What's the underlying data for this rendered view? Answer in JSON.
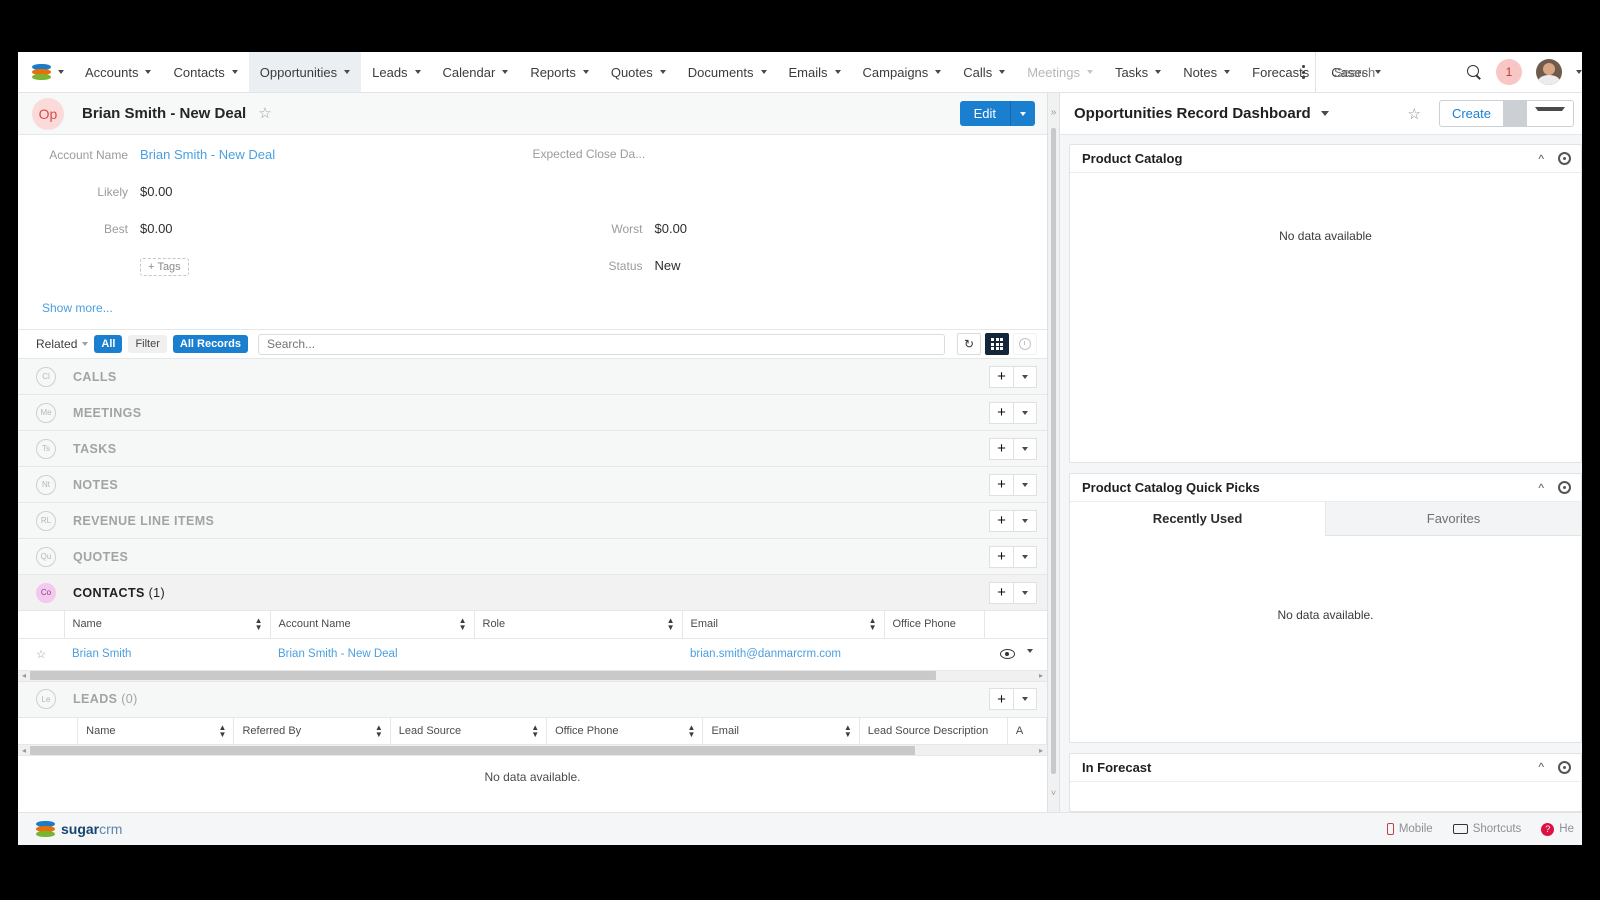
{
  "nav": {
    "logo_icon": "sugarcrm-logo-icon",
    "items": [
      {
        "label": "Accounts",
        "has_caret": true,
        "state": "normal"
      },
      {
        "label": "Contacts",
        "has_caret": true,
        "state": "normal"
      },
      {
        "label": "Opportunities",
        "has_caret": true,
        "state": "active"
      },
      {
        "label": "Leads",
        "has_caret": true,
        "state": "normal"
      },
      {
        "label": "Calendar",
        "has_caret": true,
        "state": "normal"
      },
      {
        "label": "Reports",
        "has_caret": true,
        "state": "normal"
      },
      {
        "label": "Quotes",
        "has_caret": true,
        "state": "normal"
      },
      {
        "label": "Documents",
        "has_caret": true,
        "state": "normal"
      },
      {
        "label": "Emails",
        "has_caret": true,
        "state": "normal"
      },
      {
        "label": "Campaigns",
        "has_caret": true,
        "state": "normal"
      },
      {
        "label": "Calls",
        "has_caret": true,
        "state": "normal"
      },
      {
        "label": "Meetings",
        "has_caret": true,
        "state": "dim"
      },
      {
        "label": "Tasks",
        "has_caret": true,
        "state": "normal"
      },
      {
        "label": "Notes",
        "has_caret": true,
        "state": "normal"
      },
      {
        "label": "Forecasts",
        "has_caret": false,
        "state": "normal"
      },
      {
        "label": "Cases",
        "has_caret": true,
        "state": "normal"
      }
    ],
    "search_placeholder": "Search",
    "notification_count": "1"
  },
  "record": {
    "avatar_initials": "Op",
    "title": "Brian Smith - New Deal",
    "favorite_icon": "star-outline-icon",
    "edit_label": "Edit",
    "fields": [
      {
        "label": "Account Name",
        "value": "Brian Smith - New Deal",
        "is_link": true
      },
      {
        "label": "Expected Close Da...",
        "value": ""
      },
      {
        "label": "Likely",
        "value": "$0.00"
      },
      {
        "label": "Best",
        "value": "$0.00"
      },
      {
        "label": "Worst",
        "value": "$0.00"
      },
      {
        "label": "Status",
        "value": "New"
      }
    ],
    "tags_label": "Tags",
    "show_more_label": "Show more..."
  },
  "filterbar": {
    "related_label": "Related",
    "all_label": "All",
    "filter_label": "Filter",
    "all_records_label": "All Records",
    "search_placeholder": "Search...",
    "refresh_icon": "refresh-icon",
    "grid_icon": "grid-view-icon",
    "timeline_icon": "timeline-view-icon"
  },
  "panels": [
    {
      "badge": "Cl",
      "title": "CALLS",
      "count": "",
      "state": "collapsed"
    },
    {
      "badge": "Me",
      "title": "MEETINGS",
      "count": "",
      "state": "collapsed"
    },
    {
      "badge": "Ts",
      "title": "TASKS",
      "count": "",
      "state": "collapsed"
    },
    {
      "badge": "Nt",
      "title": "NOTES",
      "count": "",
      "state": "collapsed"
    },
    {
      "badge": "RL",
      "title": "REVENUE LINE ITEMS",
      "count": "",
      "state": "collapsed"
    },
    {
      "badge": "Qu",
      "title": "QUOTES",
      "count": "",
      "state": "collapsed"
    }
  ],
  "contacts_panel": {
    "badge": "Co",
    "title": "CONTACTS",
    "count": "(1)",
    "columns": [
      "Name",
      "Account Name",
      "Role",
      "Email",
      "Office Phone"
    ],
    "rows": [
      {
        "name": "Brian Smith",
        "account_name": "Brian Smith - New Deal",
        "role": "",
        "email": "brian.smith@danmarcrm.com",
        "office_phone": ""
      }
    ]
  },
  "leads_panel": {
    "badge": "Le",
    "title": "LEADS",
    "count": "(0)",
    "columns": [
      "Name",
      "Referred By",
      "Lead Source",
      "Office Phone",
      "Email",
      "Lead Source Description",
      "A"
    ],
    "empty_text": "No data available."
  },
  "dashboard": {
    "title": "Opportunities Record Dashboard",
    "favorite_icon": "star-outline-icon",
    "create_label": "Create",
    "collapse_icon": "chevron-right-double-icon",
    "dashlets": [
      {
        "title": "Product Catalog",
        "empty_text": "No data available"
      },
      {
        "title": "Product Catalog Quick Picks",
        "tabs": [
          {
            "label": "Recently Used",
            "active": true
          },
          {
            "label": "Favorites",
            "active": false
          }
        ],
        "empty_text": "No data available."
      },
      {
        "title": "In Forecast"
      }
    ]
  },
  "footer": {
    "brand_bold": "sugar",
    "brand_light": "crm",
    "mobile_label": "Mobile",
    "shortcuts_label": "Shortcuts",
    "help_label": "He"
  }
}
